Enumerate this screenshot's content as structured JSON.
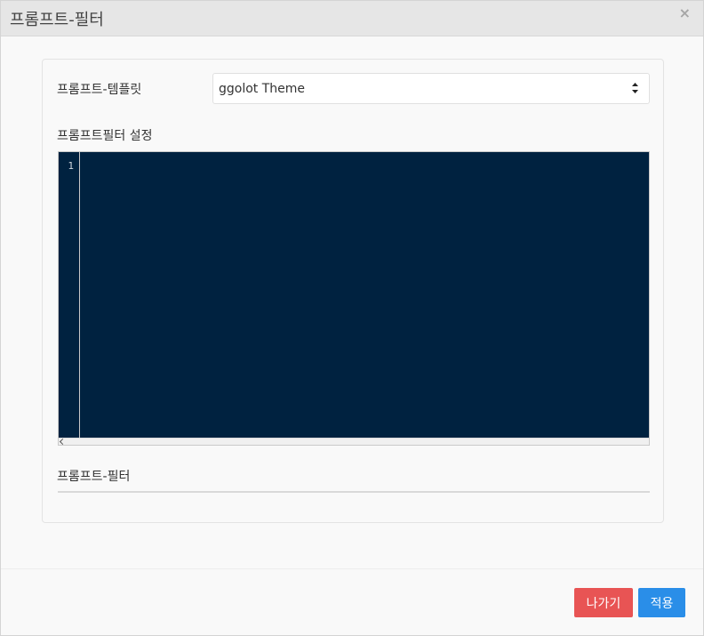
{
  "dialog": {
    "title": "프롬프트-필터",
    "close_label": "×"
  },
  "form": {
    "template_label": "프롬프트-템플릿",
    "template_value": "ggolot Theme",
    "settings_label": "프롬프트필터 설정",
    "editor_line_number": "1",
    "filter_label": "프롬프트-필터"
  },
  "footer": {
    "exit_label": "나가기",
    "apply_label": "적용"
  },
  "colors": {
    "editor_bg": "#002240",
    "exit_button": "#e85454",
    "apply_button": "#2a8ee8"
  }
}
